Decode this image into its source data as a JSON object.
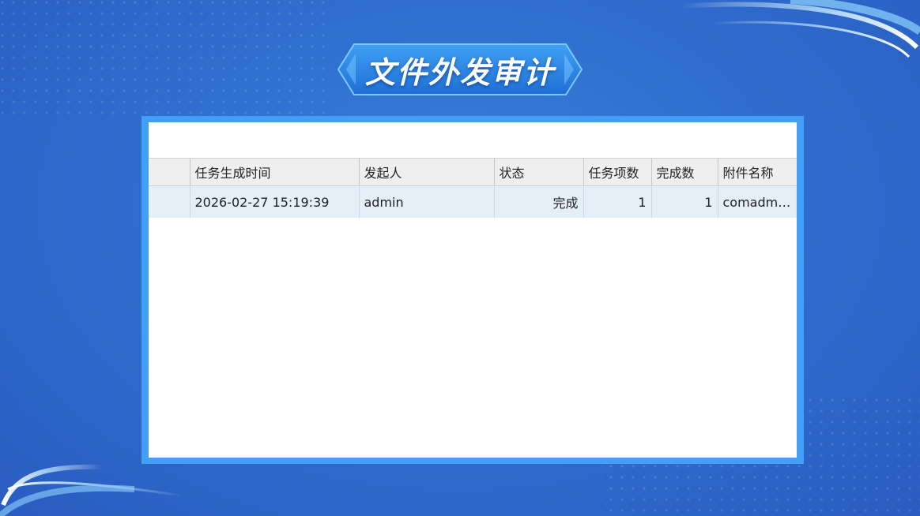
{
  "page": {
    "title": "文件外发审计"
  },
  "table": {
    "headers": {
      "row_header": "",
      "created_time": "任务生成时间",
      "initiator": "发起人",
      "status": "状态",
      "task_count": "任务项数",
      "done_count": "完成数",
      "attachment_name": "附件名称"
    },
    "rows": [
      {
        "row_header": "",
        "created_time": "2026-02-27 15:19:39",
        "initiator": "admin",
        "status": "完成",
        "task_count": "1",
        "done_count": "1",
        "attachment_name": "comadmi..."
      }
    ]
  },
  "colors": {
    "background": "#2f6fcf",
    "panel_border": "#41a0f6",
    "header_bg": "#efefef",
    "row_bg": "#e4eff8"
  }
}
